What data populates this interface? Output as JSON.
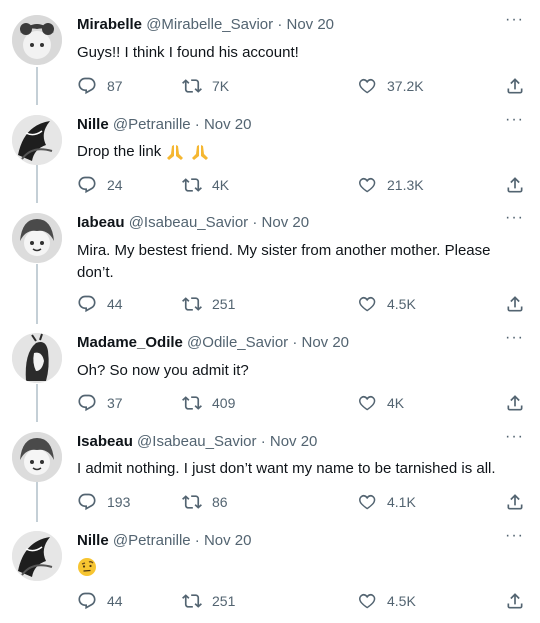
{
  "tweets": [
    {
      "name": "Mirabelle",
      "handle": "@Mirabelle_Savior",
      "date": "Nov 20",
      "text": "Guys!! I think I found his account!",
      "replies": "87",
      "retweets": "7K",
      "likes": "37.2K"
    },
    {
      "name": "Nille",
      "handle": "@Petranille",
      "date": "Nov 20",
      "text": "Drop the link",
      "replies": "24",
      "retweets": "4K",
      "likes": "21.3K"
    },
    {
      "name": "Iabeau",
      "handle": "@Isabeau_Savior",
      "date": "Nov 20",
      "text": "Mira. My bestest friend. My sister from another mother. Please don’t.",
      "replies": "44",
      "retweets": "251",
      "likes": "4.5K"
    },
    {
      "name": "Madame_Odile",
      "handle": "@Odile_Savior",
      "date": "Nov 20",
      "text": "Oh? So now you admit it?",
      "replies": "37",
      "retweets": "409",
      "likes": "4K"
    },
    {
      "name": "Isabeau",
      "handle": "@Isabeau_Savior",
      "date": "Nov 20",
      "text": "I admit nothing. I just don’t want my name to be tarnished is all.",
      "replies": "193",
      "retweets": "86",
      "likes": "4.1K"
    },
    {
      "name": "Nille",
      "handle": "@Petranille",
      "date": "Nov 20",
      "text": "",
      "replies": "44",
      "retweets": "251",
      "likes": "4.5K"
    }
  ],
  "ui": {
    "separator": "·",
    "more": "···"
  },
  "icons": {
    "reply": "reply-icon",
    "retweet": "retweet-icon",
    "like": "heart-icon",
    "share": "share-icon",
    "more": "more-icon"
  },
  "colors": {
    "text": "#0f1419",
    "secondary": "#536471",
    "thread_line": "#c4cfd6"
  }
}
